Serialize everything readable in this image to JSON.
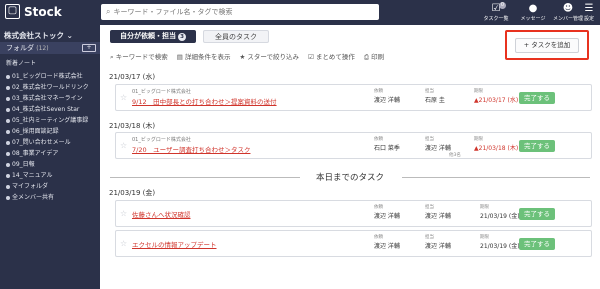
{
  "app": {
    "logo_text": "Stock"
  },
  "search": {
    "placeholder": "キーワード・ファイル名・タグで検索"
  },
  "top_icons": [
    {
      "label": "タスク一覧",
      "icon": "checkbox-icon",
      "badge": "0"
    },
    {
      "label": "メッセージ",
      "icon": "chat-icon"
    },
    {
      "label": "メンバー管理",
      "icon": "members-icon"
    },
    {
      "label": "設定",
      "icon": "menu-icon"
    }
  ],
  "sidebar": {
    "company": "株式会社ストック",
    "folder_header": "フォルダ",
    "folder_count": "(12)",
    "add_label": "+",
    "items": [
      {
        "label": "新着ノート"
      },
      {
        "label": "01_ビッグロード株式会社"
      },
      {
        "label": "02_株式会社ワールドリンク"
      },
      {
        "label": "03_株式会社マネーライン"
      },
      {
        "label": "04_株式会社Seven Star"
      },
      {
        "label": "05_社内ミーティング議事録"
      },
      {
        "label": "06_採用面談記録"
      },
      {
        "label": "07_問い合わせメール"
      },
      {
        "label": "08_事業アイデア"
      },
      {
        "label": "09_日報"
      },
      {
        "label": "14_マニュアル"
      },
      {
        "label": "マイフォルダ"
      },
      {
        "label": "全メンバー共有"
      }
    ]
  },
  "tabs": {
    "mine": "自分が依頼・担当",
    "mine_count": "3",
    "all": "全員のタスク"
  },
  "add_task_button": "+ タスクを追加",
  "toolbar": {
    "keyword": "キーワードで検索",
    "detail": "詳細条件を表示",
    "star": "スターで絞り込み",
    "bulk": "まとめて操作",
    "print": "印刷"
  },
  "dates": {
    "d1": "21/03/17 (水)",
    "d2": "21/03/18 (木)",
    "d3": "21/03/19 (金)"
  },
  "divider_label": "本日までのタスク",
  "col_labels": {
    "requester": "依頼",
    "assignee": "担当",
    "due": "期限"
  },
  "done_label": "完了する",
  "tasks": [
    {
      "project": "01_ビッグロード株式会社",
      "title": "9/12　田中部長との打ち合わせ＞提案資料の送付",
      "requester": "渡辺 洋輔",
      "assignee": "石原 圭",
      "due": "21/03/17 (水)"
    },
    {
      "project": "01_ビッグロード株式会社",
      "title": "7/20　ユーザー調査打ち合わせ＞タスク",
      "requester": "石口 菜季",
      "assignee": "渡辺 洋輔",
      "assignee_extra": "他3名",
      "due": "21/03/18 (木)"
    },
    {
      "title": "佐藤さんへ状況確認",
      "requester": "渡辺 洋輔",
      "assignee": "渡辺 洋輔",
      "due": "21/03/19 (金)"
    },
    {
      "title": "エクセルの情報アップデート",
      "requester": "渡辺 洋輔",
      "assignee": "渡辺 洋輔",
      "due": "21/03/19 (金)"
    }
  ]
}
